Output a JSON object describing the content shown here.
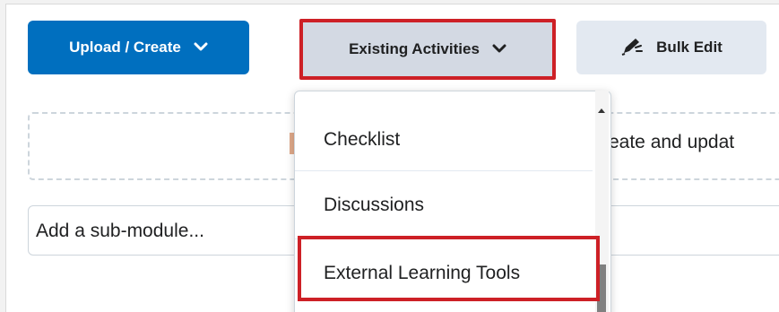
{
  "toolbar": {
    "upload_create_label": "Upload / Create",
    "existing_activities_label": "Existing Activities",
    "bulk_edit_label": "Bulk Edit"
  },
  "dropzone": {
    "visible_text": "reate and updat"
  },
  "submodule": {
    "placeholder": "Add a sub-module..."
  },
  "menu": {
    "items": [
      {
        "label": "Checklist"
      },
      {
        "label": "Discussions"
      },
      {
        "label": "External Learning Tools",
        "highlighted": true
      }
    ]
  },
  "colors": {
    "primary": "#006fbf",
    "highlight_border": "#cd2026",
    "secondary_bg": "#d3d9e3"
  },
  "icons": {
    "dropdown": "chevron-down-icon",
    "bulk_edit": "pencil-icon"
  }
}
